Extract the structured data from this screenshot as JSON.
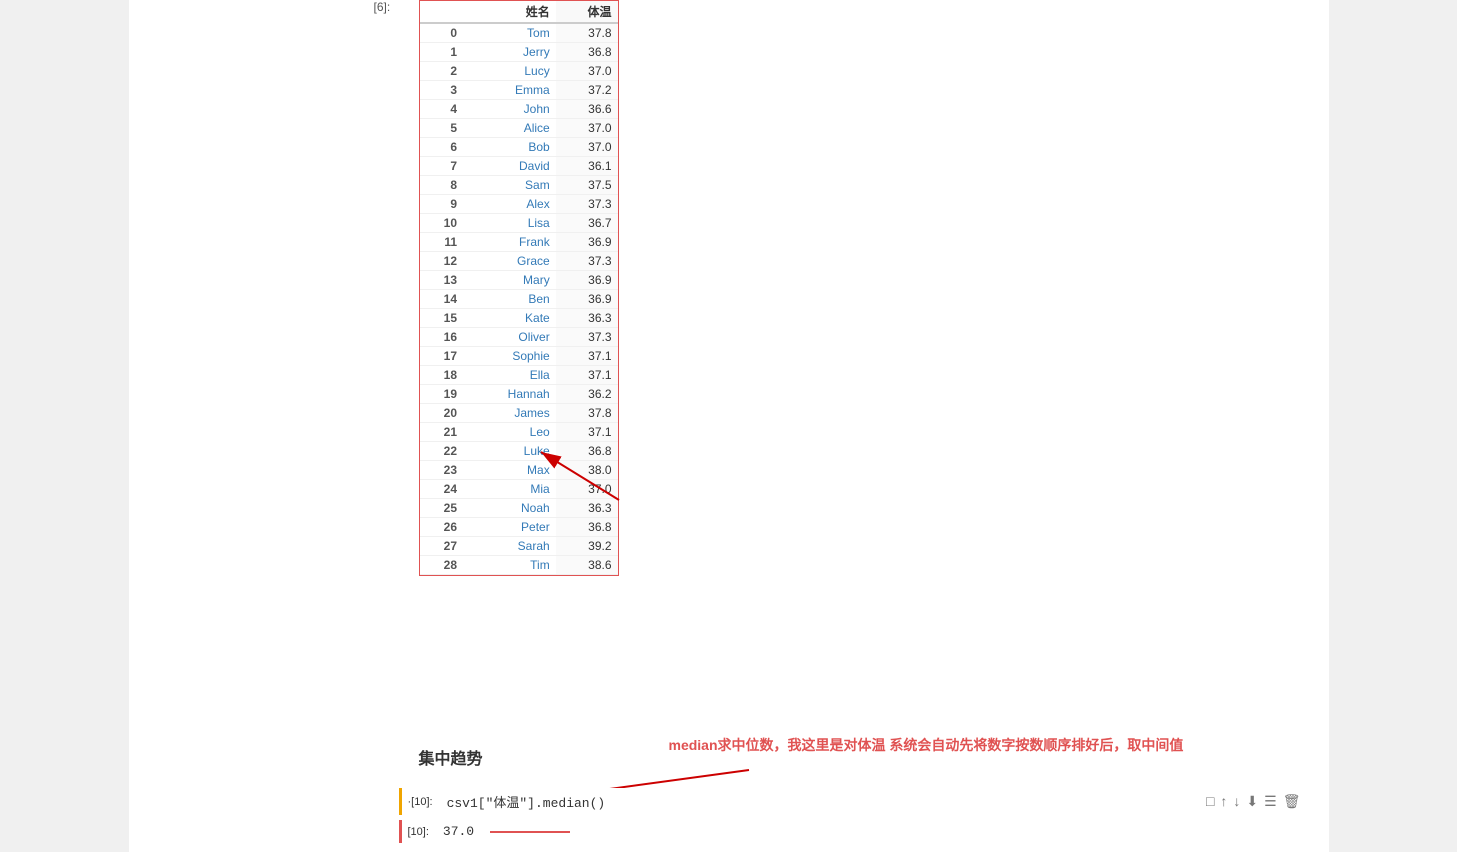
{
  "cell_label": "[6]:",
  "table": {
    "headers": [
      "姓名",
      "体温"
    ],
    "rows": [
      {
        "idx": "0",
        "name": "Tom",
        "temp": "37.8"
      },
      {
        "idx": "1",
        "name": "Jerry",
        "temp": "36.8"
      },
      {
        "idx": "2",
        "name": "Lucy",
        "temp": "37.0"
      },
      {
        "idx": "3",
        "name": "Emma",
        "temp": "37.2"
      },
      {
        "idx": "4",
        "name": "John",
        "temp": "36.6"
      },
      {
        "idx": "5",
        "name": "Alice",
        "temp": "37.0"
      },
      {
        "idx": "6",
        "name": "Bob",
        "temp": "37.0"
      },
      {
        "idx": "7",
        "name": "David",
        "temp": "36.1"
      },
      {
        "idx": "8",
        "name": "Sam",
        "temp": "37.5"
      },
      {
        "idx": "9",
        "name": "Alex",
        "temp": "37.3"
      },
      {
        "idx": "10",
        "name": "Lisa",
        "temp": "36.7"
      },
      {
        "idx": "11",
        "name": "Frank",
        "temp": "36.9"
      },
      {
        "idx": "12",
        "name": "Grace",
        "temp": "37.3"
      },
      {
        "idx": "13",
        "name": "Mary",
        "temp": "36.9"
      },
      {
        "idx": "14",
        "name": "Ben",
        "temp": "36.9"
      },
      {
        "idx": "15",
        "name": "Kate",
        "temp": "36.3"
      },
      {
        "idx": "16",
        "name": "Oliver",
        "temp": "37.3"
      },
      {
        "idx": "17",
        "name": "Sophie",
        "temp": "37.1"
      },
      {
        "idx": "18",
        "name": "Ella",
        "temp": "37.1"
      },
      {
        "idx": "19",
        "name": "Hannah",
        "temp": "36.2"
      },
      {
        "idx": "20",
        "name": "James",
        "temp": "37.8"
      },
      {
        "idx": "21",
        "name": "Leo",
        "temp": "37.1"
      },
      {
        "idx": "22",
        "name": "Luke",
        "temp": "36.8"
      },
      {
        "idx": "23",
        "name": "Max",
        "temp": "38.0"
      },
      {
        "idx": "24",
        "name": "Mia",
        "temp": "37.0"
      },
      {
        "idx": "25",
        "name": "Noah",
        "temp": "36.3"
      },
      {
        "idx": "26",
        "name": "Peter",
        "temp": "36.8"
      },
      {
        "idx": "27",
        "name": "Sarah",
        "temp": "39.2"
      },
      {
        "idx": "28",
        "name": "Tim",
        "temp": "38.6"
      }
    ]
  },
  "section_title": "集中趋势",
  "annotation": "median求中位数，我这里是对体温  系统会自动先将数字按数顺序排好后，取中间值",
  "code_cell": {
    "in_label": "·[10]:",
    "code": "csv1[\"体温\"].median()",
    "actions": [
      "□",
      "↑",
      "↓",
      "⬇",
      "☰",
      "🗑"
    ]
  },
  "output_cell": {
    "out_label": "[10]:",
    "value": "37.0"
  },
  "colors": {
    "red_border": "#e05252",
    "orange_border": "#f0a500",
    "blue_text": "#337ab7",
    "red_arrow": "#cc0000"
  }
}
